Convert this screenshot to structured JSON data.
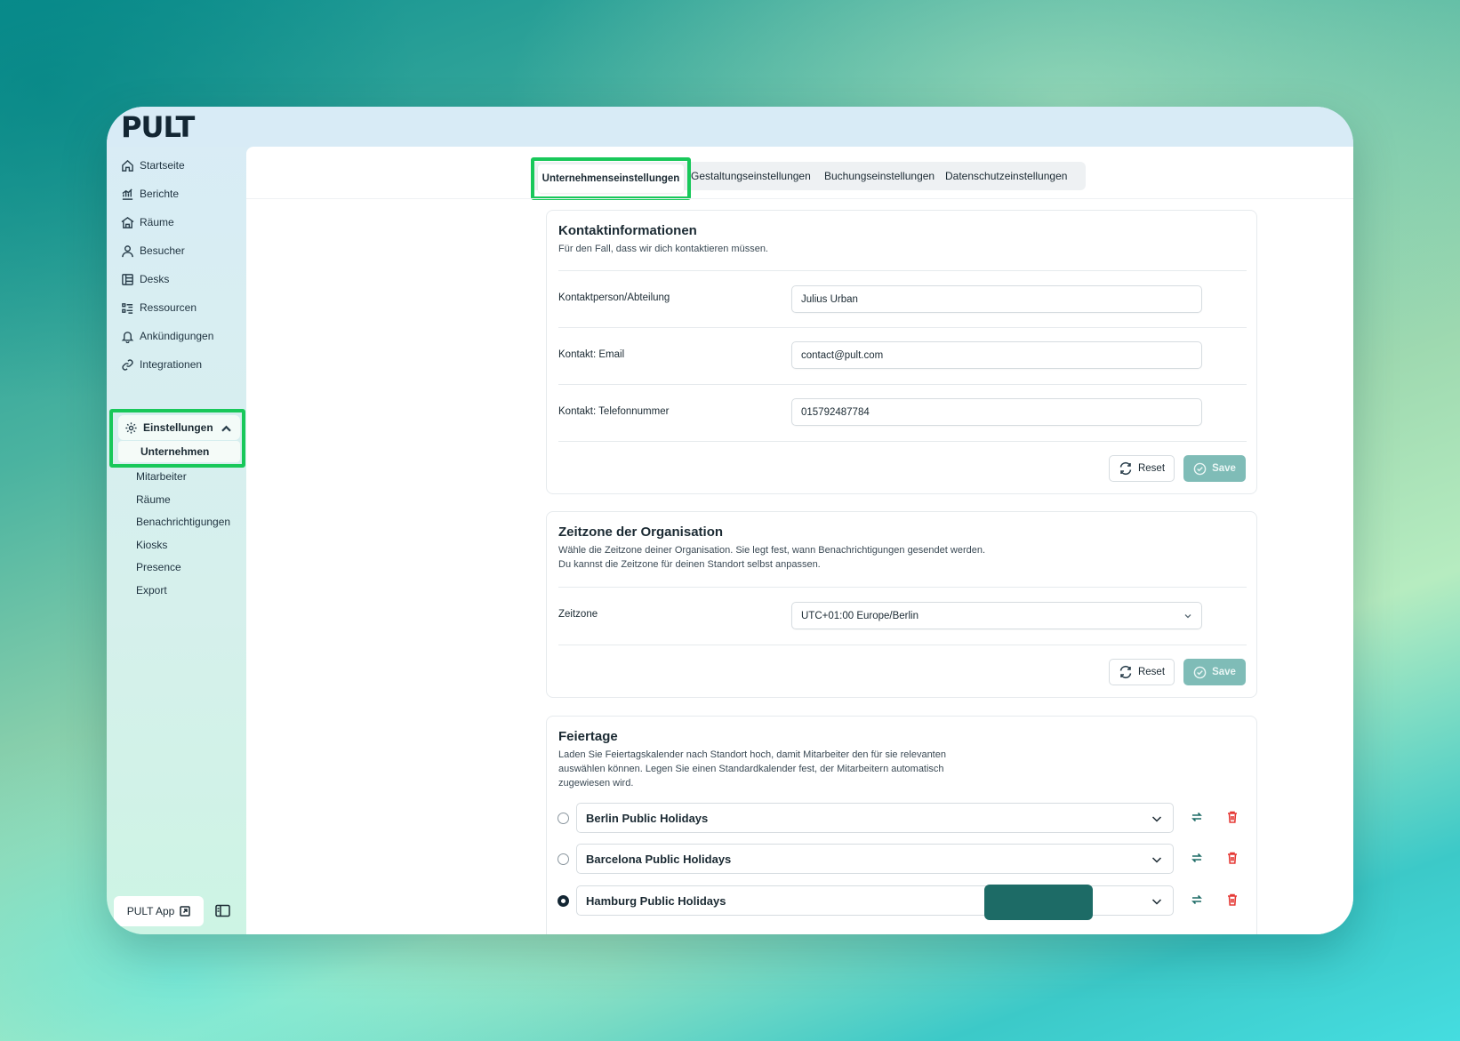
{
  "app": {
    "logo": "PULT"
  },
  "sidebar": {
    "items": [
      {
        "label": "Startseite",
        "icon": "home-icon"
      },
      {
        "label": "Berichte",
        "icon": "chart-icon"
      },
      {
        "label": "Räume",
        "icon": "rooms-icon"
      },
      {
        "label": "Besucher",
        "icon": "user-icon"
      },
      {
        "label": "Desks",
        "icon": "desk-icon"
      },
      {
        "label": "Ressourcen",
        "icon": "resources-icon"
      },
      {
        "label": "Ankündigungen",
        "icon": "bell-icon"
      },
      {
        "label": "Integrationen",
        "icon": "link-icon"
      }
    ],
    "settings": {
      "label": "Einstellungen",
      "icon": "gear-icon",
      "active_sub": "Unternehmen",
      "subitems": [
        "Mitarbeiter",
        "Räume",
        "Benachrichtigungen",
        "Kiosks",
        "Presence",
        "Export"
      ]
    },
    "app_button": "PULT App"
  },
  "tabs": {
    "active": "Unternehmenseinstellungen",
    "others": [
      "Gestaltungseinstellungen",
      "Buchungseinstellungen",
      "Datenschutzeinstellungen"
    ]
  },
  "contact": {
    "title": "Kontaktinformationen",
    "desc": "Für den Fall, dass wir dich kontaktieren müssen.",
    "fields": [
      {
        "label": "Kontaktperson/Abteilung",
        "value": "Julius Urban"
      },
      {
        "label": "Kontakt: Email",
        "value": "contact@pult.com"
      },
      {
        "label": "Kontakt: Telefonnummer",
        "value": "015792487784"
      }
    ],
    "reset": "Reset",
    "save": "Save"
  },
  "timezone": {
    "title": "Zeitzone der Organisation",
    "desc1": "Wähle die Zeitzone deiner Organisation. Sie legt fest, wann Benachrichtigungen gesendet werden.",
    "desc2": "Du kannst die Zeitzone für deinen Standort selbst anpassen.",
    "label": "Zeitzone",
    "value": "UTC+01:00 Europe/Berlin",
    "reset": "Reset",
    "save": "Save"
  },
  "holidays": {
    "title": "Feiertage",
    "desc1": "Laden Sie Feiertagskalender nach Standort hoch, damit Mitarbeiter den für sie relevanten",
    "desc2": "auswählen können. Legen Sie einen Standardkalender fest, der Mitarbeitern automatisch",
    "desc3": "zugewiesen wird.",
    "rows": [
      {
        "name": "Berlin Public Holidays",
        "default": false
      },
      {
        "name": "Barcelona Public Holidays",
        "default": false
      },
      {
        "name": "Hamburg Public Holidays",
        "default": true
      }
    ]
  },
  "colors": {
    "accent": "#18c85a",
    "save_bg": "#7fbcb7",
    "delete": "#e53935",
    "primary_dark": "#1d6b66"
  }
}
